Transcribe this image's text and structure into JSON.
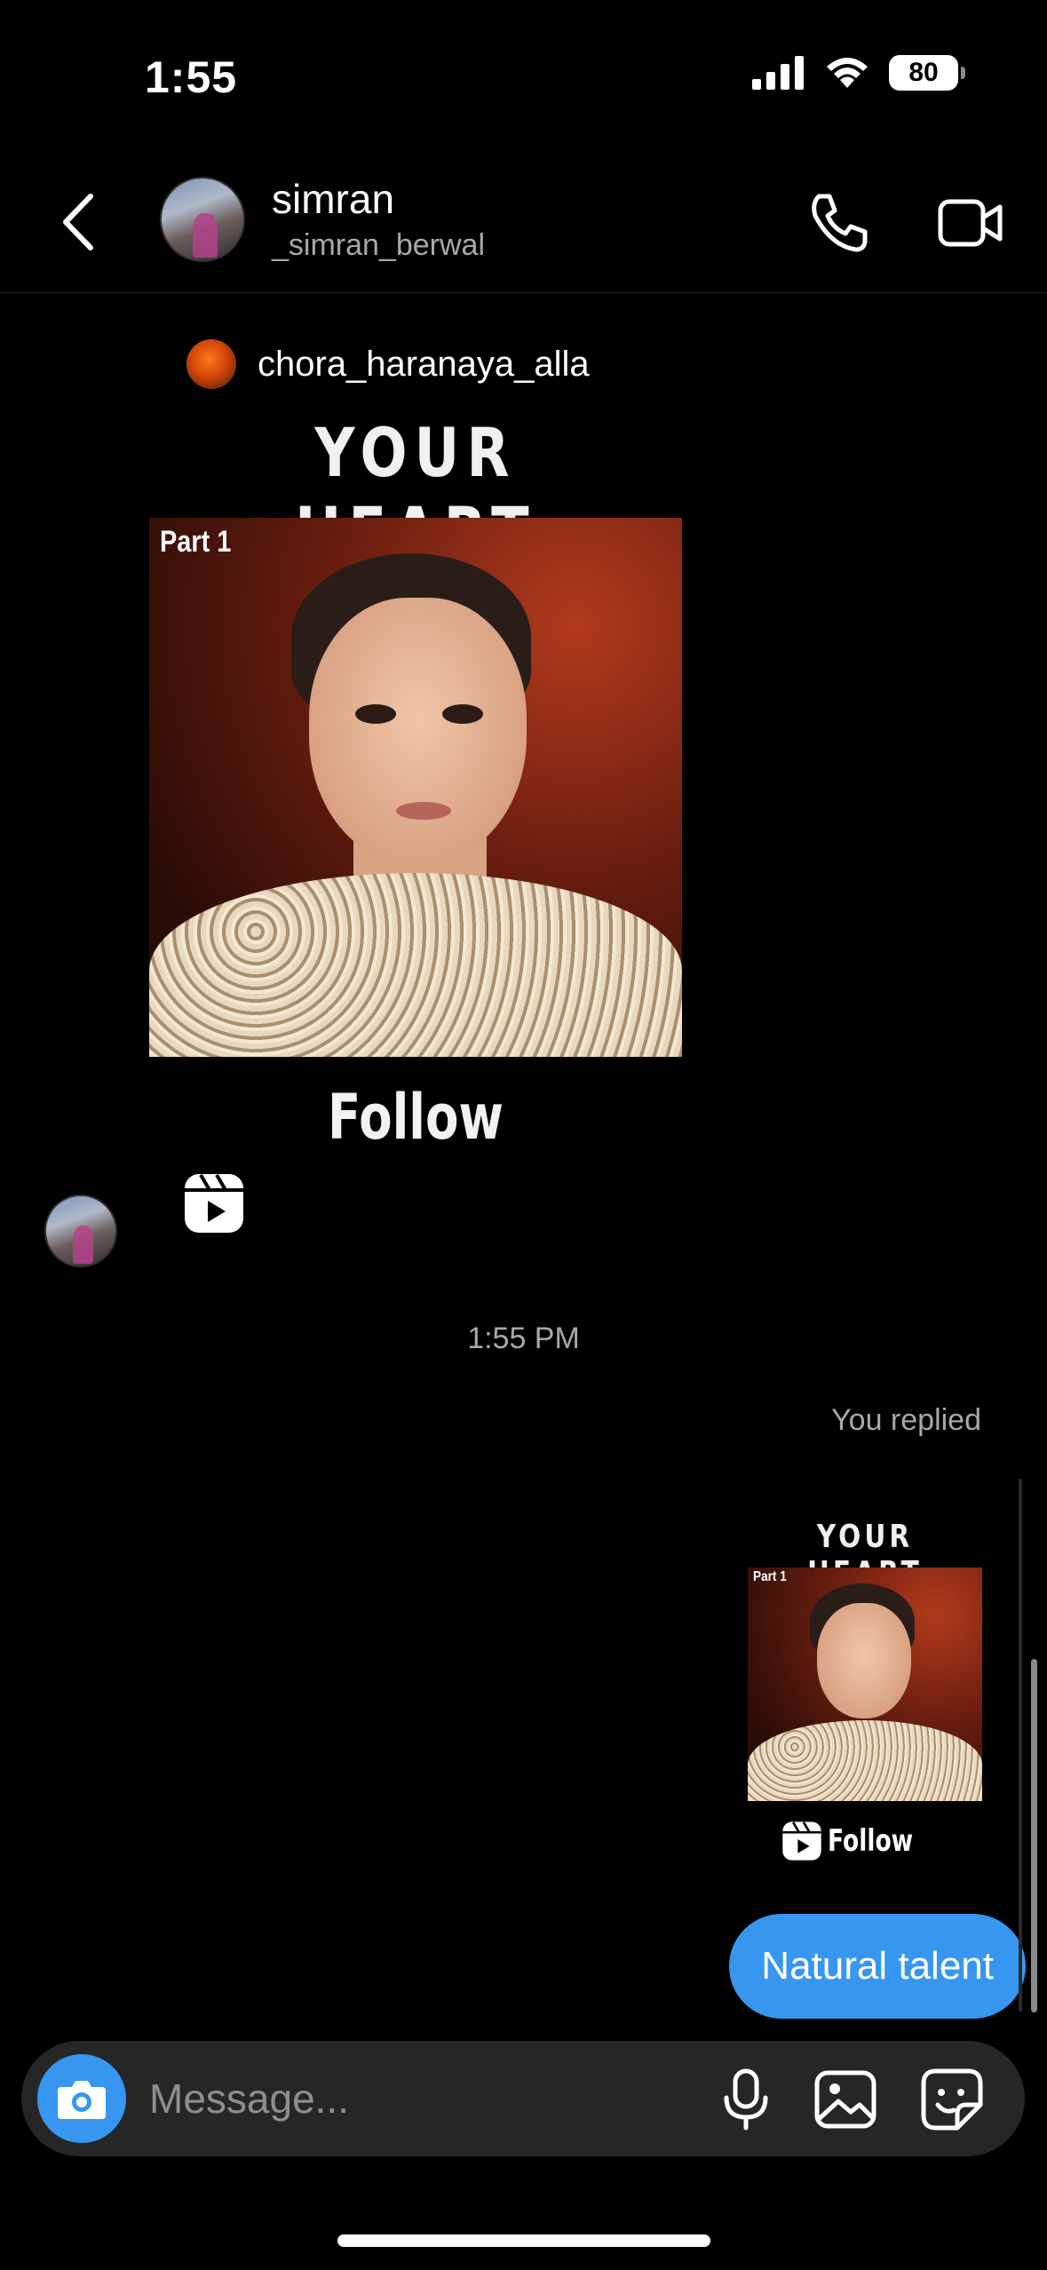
{
  "status_bar": {
    "time": "1:55",
    "battery": "80"
  },
  "header": {
    "name": "simran",
    "handle": "_simran_berwal"
  },
  "shared_post": {
    "author": "chora_haranaya_alla",
    "title": "YOUR HEART",
    "part_label": "Part 1",
    "follow_label": "Follow"
  },
  "timestamp": "1:55 PM",
  "replied_label": "You replied",
  "reply_preview": {
    "title": "YOUR HEART",
    "part_label": "Part 1",
    "follow_label": "Follow"
  },
  "outgoing_message": "Natural talent",
  "composer": {
    "placeholder": "Message..."
  },
  "colors": {
    "accent": "#3797f0",
    "background": "#000000",
    "composer_bg": "#262626"
  },
  "icons": [
    "chevron-left-icon",
    "phone-icon",
    "video-camera-icon",
    "reel-icon",
    "camera-icon",
    "microphone-icon",
    "gallery-icon",
    "sticker-icon"
  ]
}
